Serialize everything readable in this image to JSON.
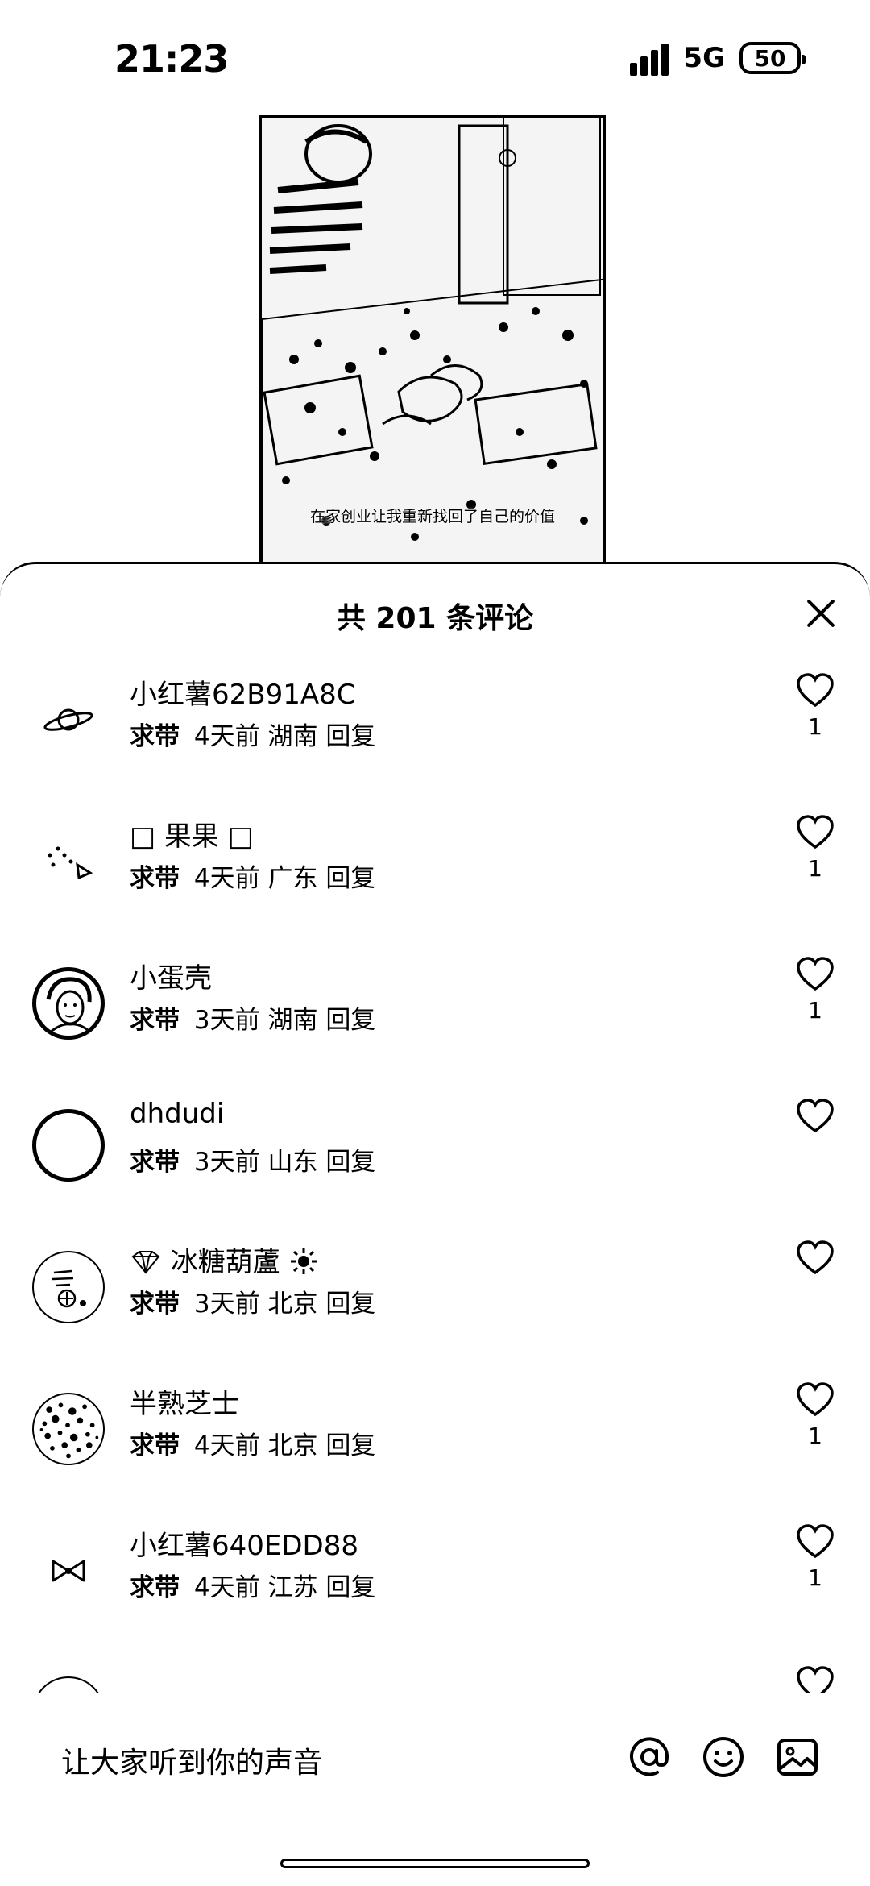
{
  "status": {
    "time": "21:23",
    "network": "5G",
    "battery": "50"
  },
  "video": {
    "subtitle": "在家创业让我重新找回了自己的价值"
  },
  "sheet": {
    "title": "共 201 条评论"
  },
  "comments": [
    {
      "user": "小红薯62B91A8C",
      "tag": "求带",
      "time": "4天前",
      "location": "湖南",
      "reply": "回复",
      "likes": "1",
      "avatar": "planet-icon"
    },
    {
      "user": "□ 果果 □",
      "tag": "求带",
      "time": "4天前",
      "location": "广东",
      "reply": "回复",
      "likes": "1",
      "avatar": "doodle-icon"
    },
    {
      "user": "小蛋壳",
      "tag": "求带",
      "time": "3天前",
      "location": "湖南",
      "reply": "回复",
      "likes": "1",
      "avatar": "portrait-photo"
    },
    {
      "user": "dhdudi",
      "tag": "求带",
      "time": "3天前",
      "location": "山东",
      "reply": "回复",
      "likes": "",
      "avatar": "empty-circle"
    },
    {
      "user": "冰糖葫蘆",
      "tag": "求带",
      "time": "3天前",
      "location": "北京",
      "reply": "回复",
      "likes": "",
      "avatar": "sticker-avatar"
    },
    {
      "user": "半熟芝士",
      "tag": "求带",
      "time": "4天前",
      "location": "北京",
      "reply": "回复",
      "likes": "1",
      "avatar": "texture-photo"
    },
    {
      "user": "小红薯640EDD88",
      "tag": "求带",
      "time": "4天前",
      "location": "江苏",
      "reply": "回复",
      "likes": "1",
      "avatar": "bow-icon"
    }
  ],
  "input": {
    "placeholder": "让大家听到你的声音"
  },
  "icons": {
    "mention": "at-icon",
    "emoji": "smiley-icon",
    "image": "image-icon",
    "like": "heart-icon"
  }
}
